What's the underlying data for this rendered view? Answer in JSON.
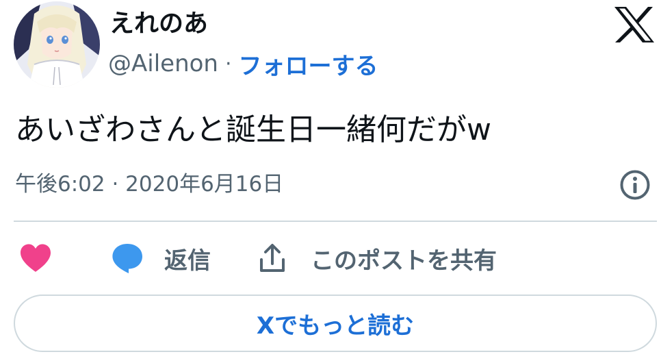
{
  "author": {
    "display_name": "えれのあ",
    "handle": "@Ailenon",
    "separator": "·",
    "follow_label": "フォローする"
  },
  "tweet": {
    "text": "あいざわさんと誕生日一緒何だがw",
    "timestamp": "午後6:02 · 2020年6月16日"
  },
  "actions": {
    "reply_label": "返信",
    "share_label": "このポストを共有"
  },
  "read_more_label": "Xでもっと読む",
  "icons": {
    "brand": "x-logo-icon",
    "info": "info-icon",
    "like": "heart-icon",
    "reply": "speech-bubble-icon",
    "share": "share-upload-icon"
  },
  "colors": {
    "link_blue": "#1d6fd6",
    "like_pink": "#f0418b",
    "reply_blue": "#3d98ee",
    "secondary_text": "#536471",
    "divider": "#cfd9de"
  }
}
